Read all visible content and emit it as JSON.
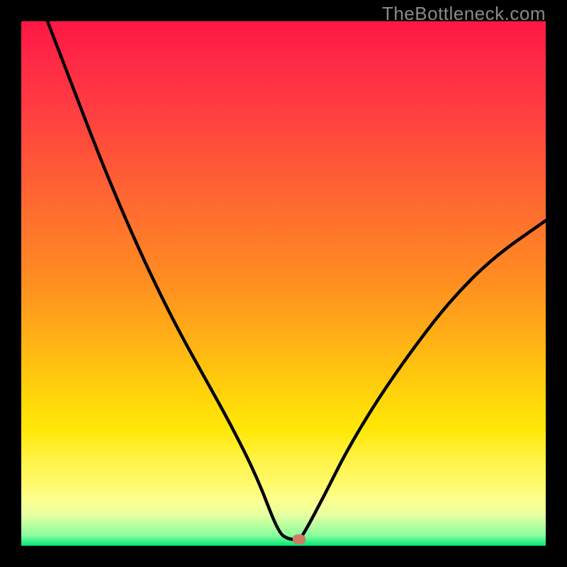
{
  "watermark": "TheBottleneck.com",
  "colors": {
    "curve": "#000000",
    "marker": "#d07a66"
  },
  "chart_data": {
    "type": "line",
    "title": "",
    "xlabel": "",
    "ylabel": "",
    "xlim": [
      0,
      100
    ],
    "ylim": [
      0,
      100
    ],
    "grid": false,
    "legend": false,
    "series": [
      {
        "name": "bottleneck-curve",
        "x": [
          5,
          10,
          15,
          20,
          25,
          30,
          35,
          40,
          45,
          49,
          51,
          53,
          54,
          58,
          62,
          68,
          75,
          82,
          90,
          100
        ],
        "y": [
          100,
          87,
          74,
          62,
          51,
          41,
          32,
          23,
          13,
          2.5,
          1.2,
          1.2,
          2.5,
          10,
          18,
          28,
          38,
          47,
          55,
          62
        ]
      }
    ],
    "marker": {
      "x": 53,
      "y": 1.2
    }
  }
}
